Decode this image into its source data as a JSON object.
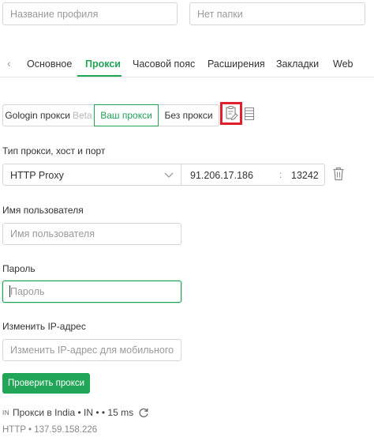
{
  "header": {
    "profile_name_placeholder": "Название профиля",
    "folder_placeholder": "Нет папки"
  },
  "tabs": {
    "items": [
      {
        "label": "Основное"
      },
      {
        "label": "Прокси"
      },
      {
        "label": "Часовой пояс"
      },
      {
        "label": "Расширения"
      },
      {
        "label": "Закладки"
      },
      {
        "label": "Web"
      }
    ],
    "active": "Прокси",
    "prev_arrow": "‹"
  },
  "proxy_mode": {
    "gologin_label": "Gologin прокси",
    "gologin_badge": "Beta",
    "own_label": "Ваш прокси",
    "none_label": "Без прокси",
    "active": "Ваш прокси",
    "icons": [
      "paste-icon",
      "list-icon"
    ],
    "highlight_color": "#e0202c"
  },
  "proxy_settings": {
    "section_label": "Тип прокси, хост и порт",
    "type_value": "HTTP Proxy",
    "host_value": "91.206.17.186",
    "separator": ":",
    "port_value": "13242"
  },
  "username": {
    "label": "Имя пользователя",
    "placeholder": "Имя пользователя"
  },
  "password": {
    "label": "Пароль",
    "placeholder": "Пароль"
  },
  "ip_change": {
    "label": "Изменить IP-адрес",
    "placeholder": "Изменить IP-адрес для мобильного ..."
  },
  "check_button": "Проверить прокси",
  "status": {
    "flag": "IN",
    "text": "Прокси в India • IN • • 15 ms",
    "detail": "HTTP • 137.59.158.226"
  },
  "colors": {
    "accent": "#21a557",
    "border": "#d6d6d6",
    "focus_border": "#21a557"
  }
}
